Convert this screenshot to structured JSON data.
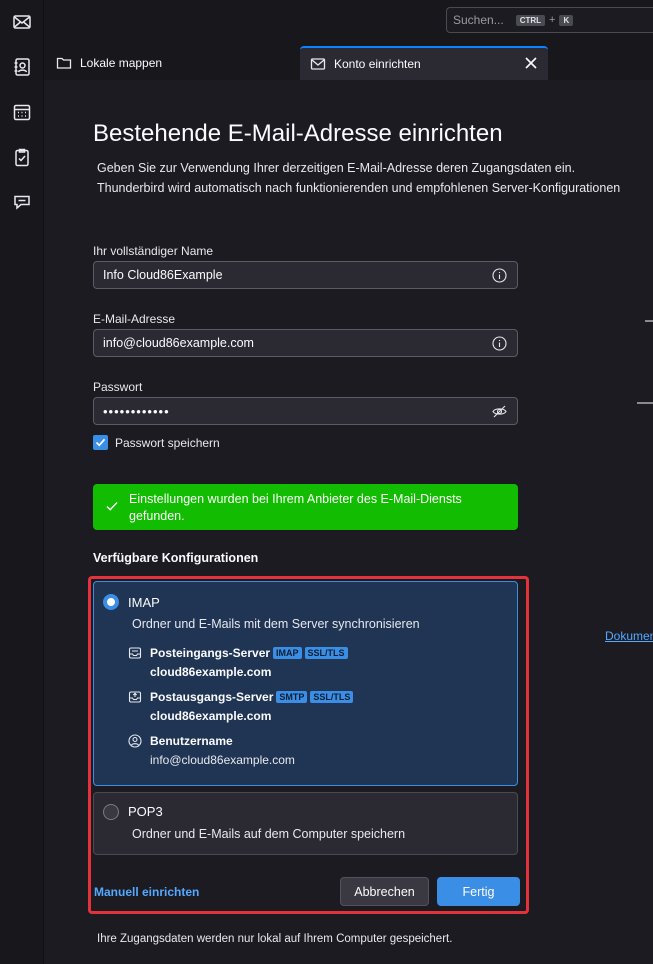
{
  "spaces": {
    "items": [
      {
        "icon": "mail-icon"
      },
      {
        "icon": "address-book-icon"
      },
      {
        "icon": "calendar-icon"
      },
      {
        "icon": "tasks-icon"
      },
      {
        "icon": "chat-icon"
      }
    ]
  },
  "search": {
    "placeholder": "Suchen...",
    "shortcut_key1": "CTRL",
    "shortcut_plus": "+",
    "shortcut_key2": "K"
  },
  "tabs": [
    {
      "label": "Lokale mappen",
      "icon": "folder-icon"
    },
    {
      "label": "Konto einrichten",
      "icon": "mail-setup-icon",
      "active": true
    }
  ],
  "page": {
    "title": "Bestehende E-Mail-Adresse einrichten",
    "intro_line1": "Geben Sie zur Verwendung Ihrer derzeitigen E-Mail-Adresse deren Zugangsdaten ein.",
    "intro_line2": "Thunderbird wird automatisch nach funktionierenden und empfohlenen Server-Konfigurationen",
    "name_label": "Ihr vollständiger Name",
    "name_value": "Info Cloud86Example",
    "email_label": "E-Mail-Adresse",
    "email_value": "info@cloud86example.com",
    "password_label": "Passwort",
    "password_value": "••••••••••••",
    "remember_password_label": "Passwort speichern",
    "remember_password_checked": true,
    "notice_text": "Einstellungen wurden bei Ihrem Anbieter des E-Mail-Diensts gefunden.",
    "configs_title": "Verfügbare Konfigurationen",
    "doc_link": "Dokumen",
    "footer_note": "Ihre Zugangsdaten werden nur lokal auf Ihrem Computer gespeichert."
  },
  "configs": {
    "imap": {
      "name": "IMAP",
      "selected": true,
      "description": "Ordner und E-Mails mit dem Server synchronisieren",
      "incoming_label": "Posteingangs-Server",
      "incoming_badges": [
        "IMAP",
        "SSL/TLS"
      ],
      "incoming_host": "cloud86example.com",
      "outgoing_label": "Postausgangs-Server",
      "outgoing_badges": [
        "SMTP",
        "SSL/TLS"
      ],
      "outgoing_host": "cloud86example.com",
      "username_label": "Benutzername",
      "username_value": "info@cloud86example.com"
    },
    "pop3": {
      "name": "POP3",
      "selected": false,
      "description": "Ordner und E-Mails auf dem Computer speichern"
    }
  },
  "actions": {
    "manual_setup": "Manuell einrichten",
    "cancel": "Abbrechen",
    "done": "Fertig"
  },
  "colors": {
    "accent": "#3a8ee6",
    "success": "#12bc00",
    "highlight": "#e4323b"
  }
}
